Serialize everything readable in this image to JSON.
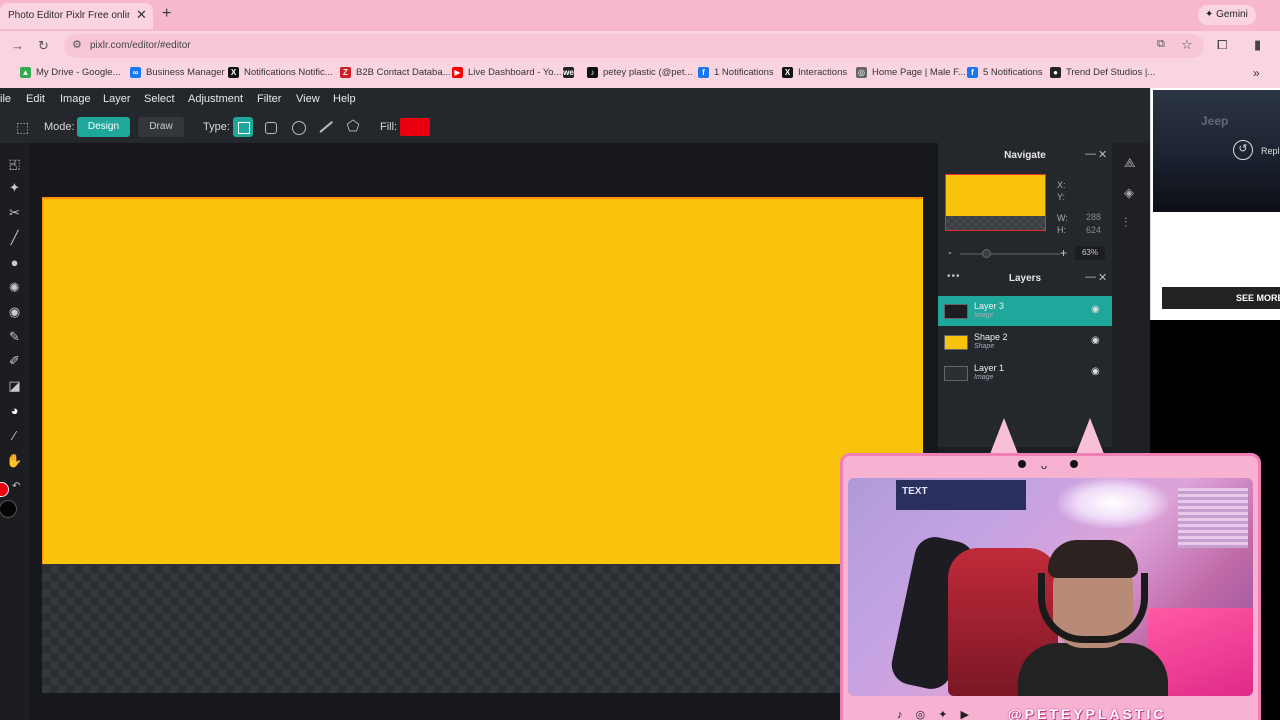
{
  "browser": {
    "tab_title": "Photo Editor Pixlr Free online In",
    "url": "pixlr.com/editor/#editor",
    "gemini_label": "✦ Gemini",
    "bookmarks": [
      {
        "label": "My Drive - Google...",
        "icon": "google-drive-icon",
        "color": "#34a853",
        "glyph": "▲"
      },
      {
        "label": "Business Manager",
        "icon": "meta-icon",
        "color": "#1877f2",
        "glyph": "∞"
      },
      {
        "label": "Notifications Notific...",
        "icon": "x-icon",
        "color": "#111111",
        "glyph": "X"
      },
      {
        "label": "B2B Contact Databa...",
        "icon": "zoominfo-icon",
        "color": "#d11f26",
        "glyph": "Z"
      },
      {
        "label": "Live Dashboard - Yo...",
        "icon": "youtube-icon",
        "color": "#ff0000",
        "glyph": "▶"
      },
      {
        "label": "",
        "icon": "we-icon",
        "color": "#222222",
        "glyph": "we"
      },
      {
        "label": "petey plastic (@pet...",
        "icon": "tiktok-icon",
        "color": "#111111",
        "glyph": "♪"
      },
      {
        "label": "1 Notifications",
        "icon": "facebook-icon",
        "color": "#1877f2",
        "glyph": "f"
      },
      {
        "label": "Interactions",
        "icon": "x-icon",
        "color": "#111111",
        "glyph": "X"
      },
      {
        "label": "Home Page | Male F...",
        "icon": "globe-icon",
        "color": "#666666",
        "glyph": "◎"
      },
      {
        "label": "5 Notifications",
        "icon": "facebook-icon",
        "color": "#1877f2",
        "glyph": "f"
      },
      {
        "label": "Trend Def Studios |...",
        "icon": "studio-icon",
        "color": "#222222",
        "glyph": "●"
      }
    ]
  },
  "menu": [
    "ile",
    "Edit",
    "Image",
    "Layer",
    "Select",
    "Adjustment",
    "Filter",
    "View",
    "Help"
  ],
  "options": {
    "mode_label": "Mode:",
    "mode_design": "Design",
    "mode_draw": "Draw",
    "type_label": "Type:",
    "fill_label": "Fill:",
    "fill_color": "#e8000f"
  },
  "navigate": {
    "title": "Navigate",
    "x_label": "X:",
    "y_label": "Y:",
    "w_label": "W:",
    "h_label": "H:",
    "w_value": "288",
    "h_value": "624",
    "zoom_minus": "-",
    "zoom_plus": "+",
    "zoom": "63%"
  },
  "layers": {
    "title": "Layers",
    "items": [
      {
        "name": "Layer 3",
        "type": "Image",
        "thumb": "#1b1d21",
        "visible": true,
        "active": true
      },
      {
        "name": "Shape 2",
        "type": "Shape",
        "thumb": "#f9c20b",
        "visible": true,
        "active": false
      },
      {
        "name": "Layer 1",
        "type": "Image",
        "thumb": "#2b2e32",
        "visible": true,
        "active": false
      }
    ]
  },
  "ad": {
    "video_text": "Jeep",
    "replay_label": "Repl",
    "see_more": "SEE MORE"
  },
  "stream_overlay": {
    "sign_text": "TEXT",
    "social_icons": "♪ ◎ ✦ ▶",
    "handle": "@PETEYPLASTIC"
  },
  "colors": {
    "accent": "#1ea79a",
    "canvas_fill": "#f9c20b",
    "foreground": "#e8000f",
    "background": "#050505"
  }
}
